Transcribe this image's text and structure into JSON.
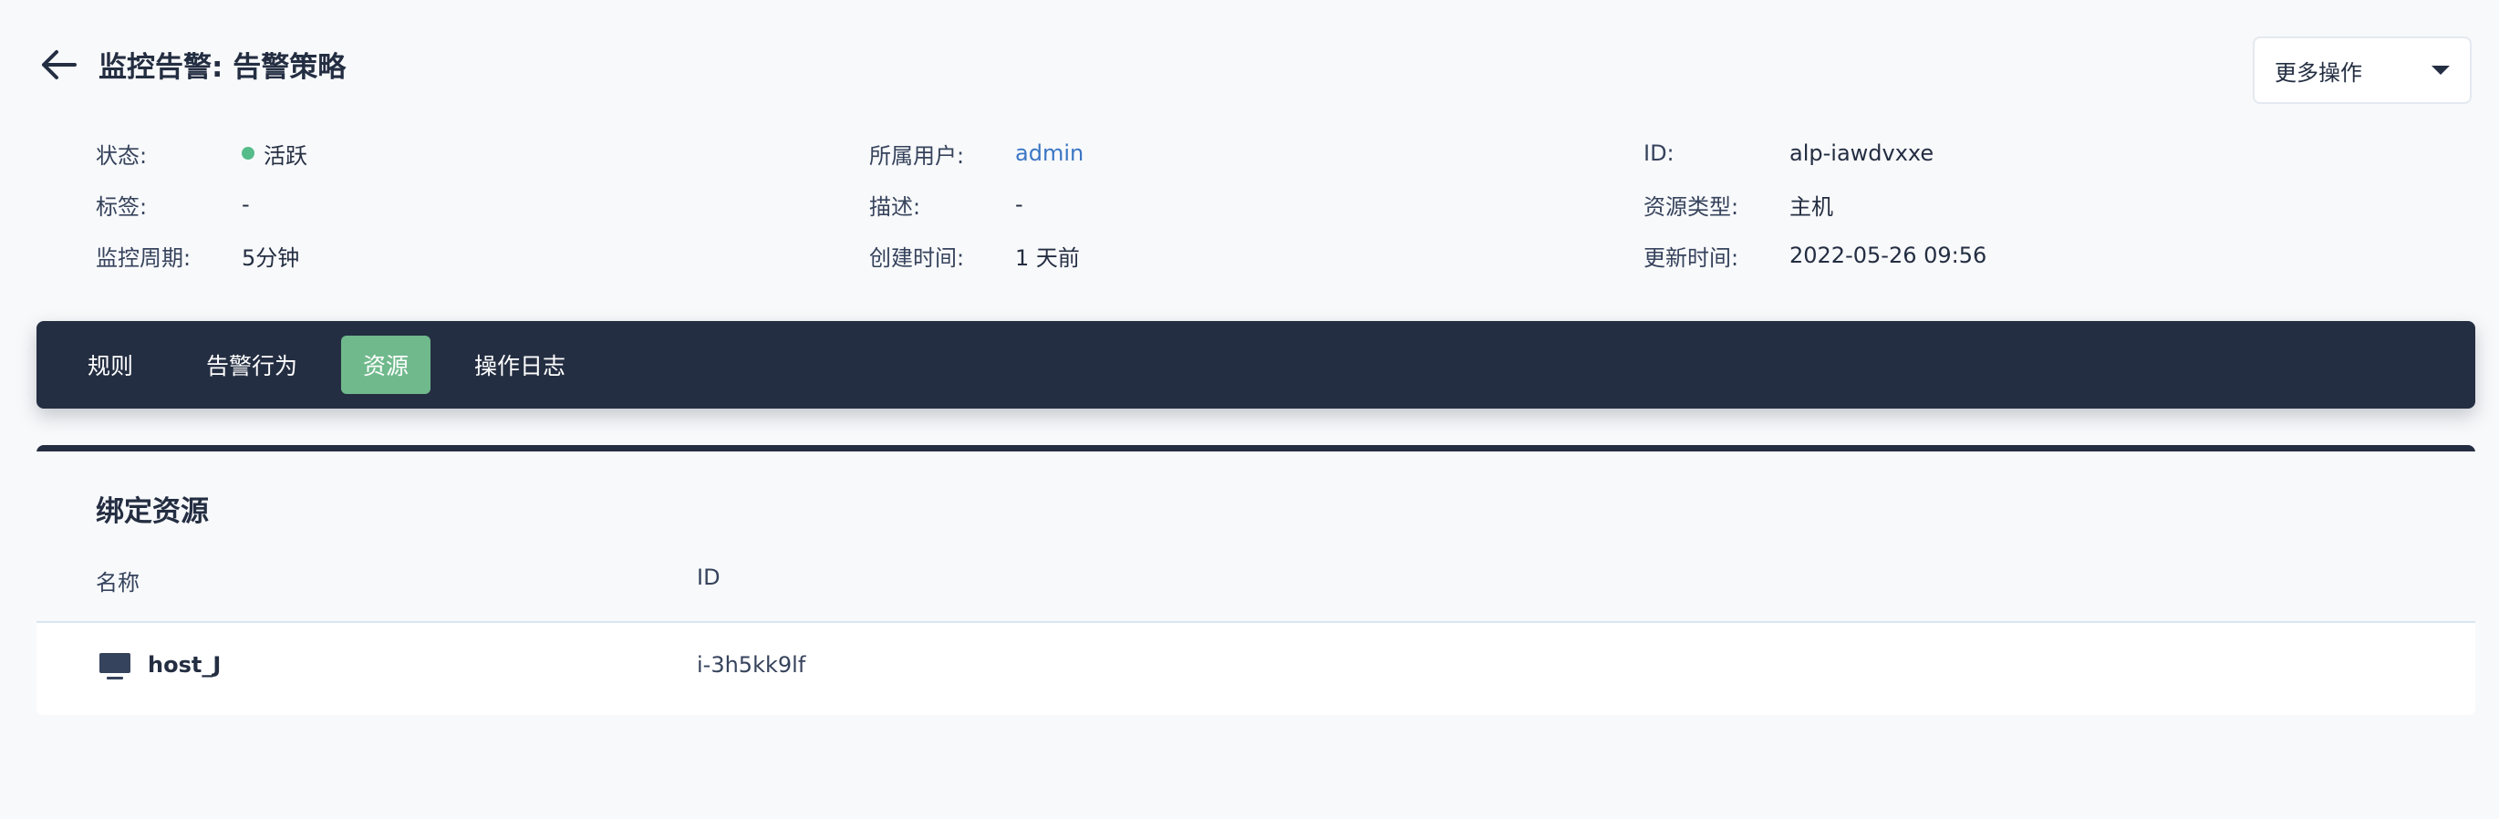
{
  "header": {
    "title": "监控告警: 告警策略",
    "more_actions_label": "更多操作"
  },
  "info": {
    "col1": [
      {
        "label": "状态:",
        "value": "活跃"
      },
      {
        "label": "标签:",
        "value": "-"
      },
      {
        "label": "监控周期:",
        "value": "5分钟"
      }
    ],
    "col2": [
      {
        "label": "所属用户:",
        "value": "admin"
      },
      {
        "label": "描述:",
        "value": "-"
      },
      {
        "label": "创建时间:",
        "value": "1 天前"
      }
    ],
    "col3": [
      {
        "label": "ID:",
        "value": "alp-iawdvxxe"
      },
      {
        "label": "资源类型:",
        "value": "主机"
      },
      {
        "label": "更新时间:",
        "value": "2022-05-26 09:56"
      }
    ]
  },
  "tabs": [
    {
      "label": "规则",
      "active": false
    },
    {
      "label": "告警行为",
      "active": false
    },
    {
      "label": "资源",
      "active": true
    },
    {
      "label": "操作日志",
      "active": false
    }
  ],
  "resources": {
    "title": "绑定资源",
    "columns": [
      "名称",
      "ID"
    ],
    "rows": [
      {
        "icon": "monitor-icon",
        "name": "host_J",
        "id": "i-3h5kk9lf"
      }
    ]
  },
  "colors": {
    "dark": "#242e42",
    "accent_green": "#70b98c",
    "status_green": "#55bc8a",
    "link_blue": "#3b76c4"
  }
}
